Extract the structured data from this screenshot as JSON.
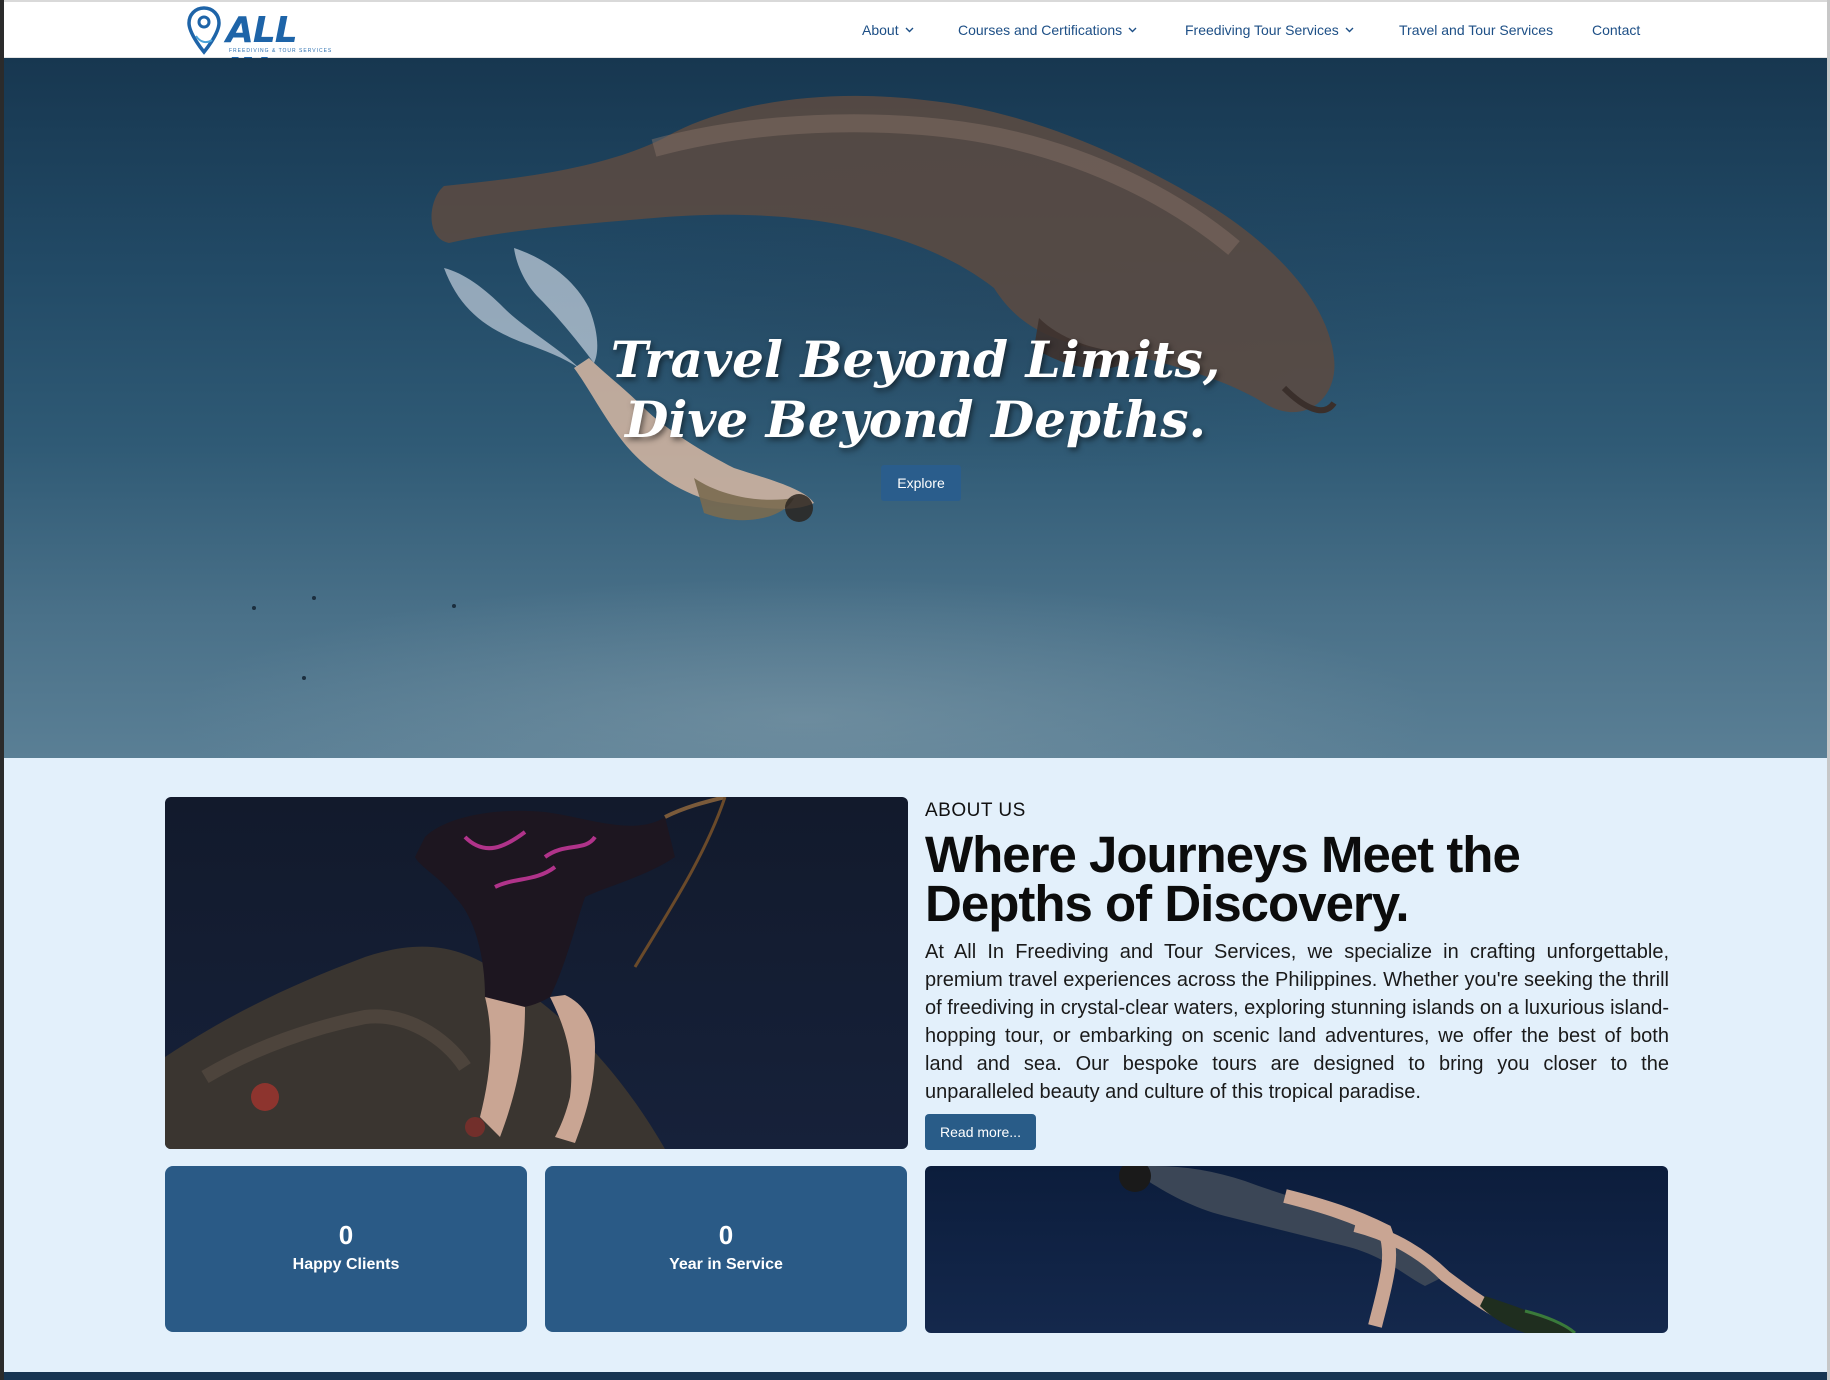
{
  "brand": {
    "logo_text": "ALL IN",
    "tagline": "FREEDIVING & TOUR SERVICES",
    "primary_color": "#295c88",
    "logo_color": "#1e64a8"
  },
  "nav": {
    "items": [
      {
        "label": "About",
        "has_dropdown": true
      },
      {
        "label": "Courses and Certifications",
        "has_dropdown": true
      },
      {
        "label": "Freediving Tour Services",
        "has_dropdown": true
      },
      {
        "label": "Travel and Tour Services",
        "has_dropdown": false
      },
      {
        "label": "Contact",
        "has_dropdown": false
      }
    ]
  },
  "hero": {
    "title_line1": "Travel Beyond Limits,",
    "title_line2": "Dive Beyond Depths.",
    "button_label": "Explore"
  },
  "about": {
    "eyebrow": "ABOUT US",
    "title": "Where Journeys Meet the Depths of Discovery.",
    "body": "At All In Freediving and Tour Services, we specialize in crafting unforgettable, premium travel experiences across the Philippines. Whether you're seeking the thrill of freediving in crystal-clear waters, exploring stunning islands on a luxurious island-hopping tour, or embarking on scenic land adventures, we offer the best of both land and sea. Our bespoke tours are designed to bring you closer to the unparalleled beauty and culture of this tropical paradise.",
    "button_label": "Read more..."
  },
  "stats": [
    {
      "value": "0",
      "label": "Happy Clients"
    },
    {
      "value": "0",
      "label": "Year in Service"
    }
  ]
}
